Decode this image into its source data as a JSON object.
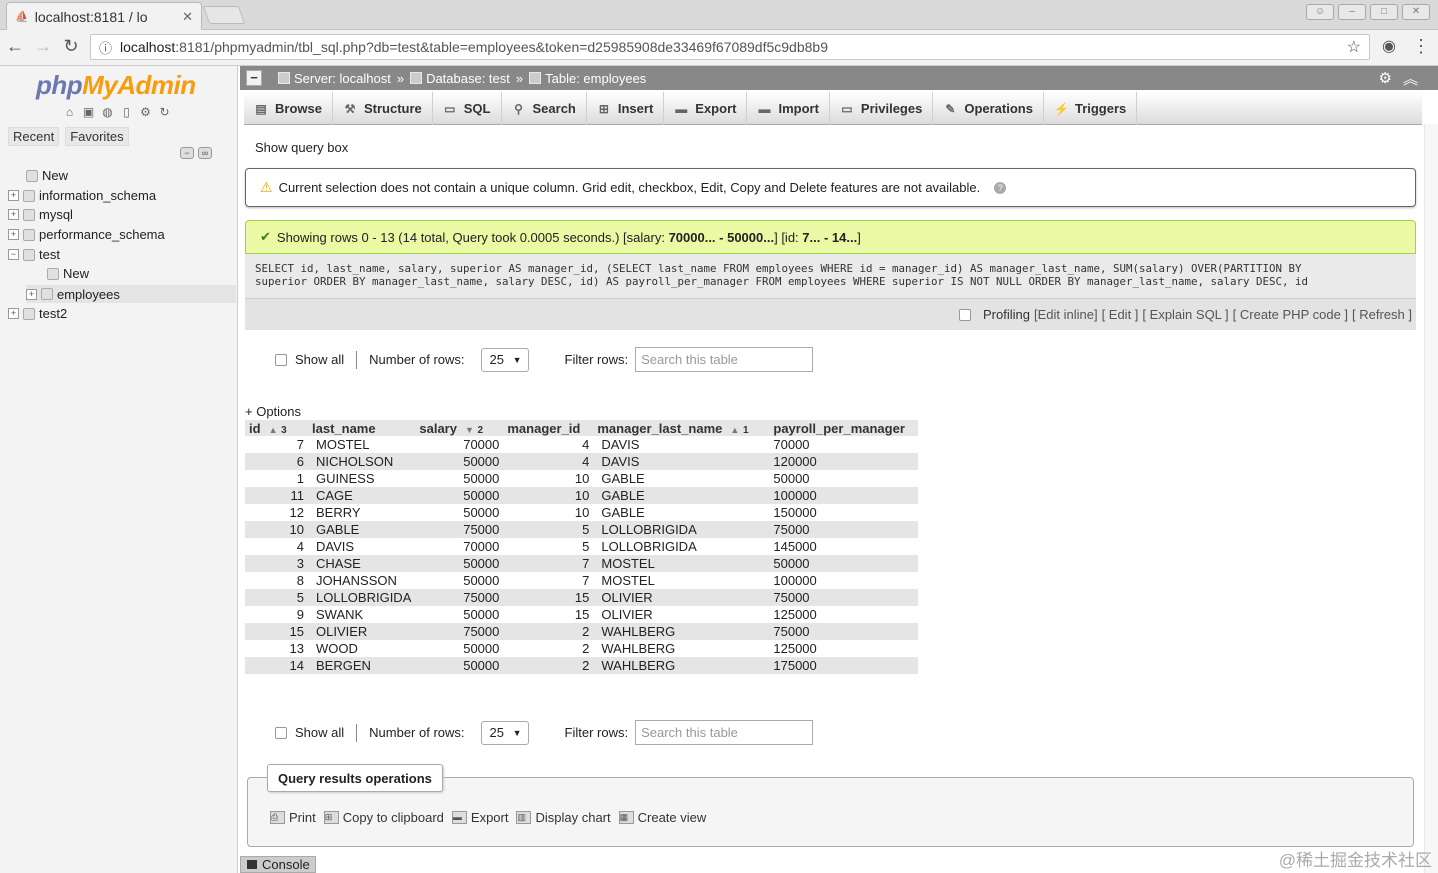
{
  "browser": {
    "tab_title": "localhost:8181 / lo",
    "url_host": "localhost",
    "url_rest": ":8181/phpmyadmin/tbl_sql.php?db=test&table=employees&token=d25985908de33469f67089df5c9db8b9"
  },
  "sidebar": {
    "logo_php": "php",
    "logo_myadmin": "MyAdmin",
    "tabs": [
      "Recent",
      "Favorites"
    ],
    "tree": [
      {
        "label": "New",
        "level": 1
      },
      {
        "label": "information_schema",
        "level": 0
      },
      {
        "label": "mysql",
        "level": 0
      },
      {
        "label": "performance_schema",
        "level": 0
      },
      {
        "label": "test",
        "level": 0
      },
      {
        "label": "New",
        "level": 2
      },
      {
        "label": "employees",
        "level": 2
      },
      {
        "label": "test2",
        "level": 0
      }
    ]
  },
  "breadcrumb": {
    "server": "Server: localhost",
    "database": "Database: test",
    "table": "Table: employees",
    "sep": "»"
  },
  "tabs": [
    "Browse",
    "Structure",
    "SQL",
    "Search",
    "Insert",
    "Export",
    "Import",
    "Privileges",
    "Operations",
    "Triggers"
  ],
  "show_query_box": "Show query box",
  "notice": "Current selection does not contain a unique column. Grid edit, checkbox, Edit, Copy and Delete features are not available.",
  "success": {
    "prefix": "Showing rows 0 - 13 (14 total, Query took 0.0005 seconds.) [salary: ",
    "salary_range": "70000... - 50000...",
    "mid": "] [id: ",
    "id_range": "7... - 14...",
    "suffix": "]"
  },
  "sql": {
    "line1": "SELECT id, last_name, salary, superior AS manager_id, (SELECT last_name FROM employees WHERE id = manager_id) AS manager_last_name, SUM(salary) OVER(PARTITION BY",
    "line2": "superior ORDER BY manager_last_name, salary DESC, id) AS payroll_per_manager FROM employees WHERE superior IS NOT NULL ORDER BY manager_last_name, salary DESC, id"
  },
  "sql_tools": {
    "profiling": "Profiling",
    "edit_inline": "[Edit inline]",
    "edit": "[ Edit ]",
    "explain": "[ Explain SQL ]",
    "php": "[ Create PHP code ]",
    "refresh": "[ Refresh ]"
  },
  "controls": {
    "show_all": "Show all",
    "num_rows_label": "Number of rows:",
    "num_rows_value": "25",
    "filter_label": "Filter rows:",
    "filter_placeholder": "Search this table"
  },
  "options_label": "+ Options",
  "table": {
    "headers": [
      {
        "label": "id",
        "sort": "▲",
        "order": "3"
      },
      {
        "label": "last_name",
        "sort": "",
        "order": ""
      },
      {
        "label": "salary",
        "sort": "▼",
        "order": "2"
      },
      {
        "label": "manager_id",
        "sort": "",
        "order": ""
      },
      {
        "label": "manager_last_name",
        "sort": "▲",
        "order": "1"
      },
      {
        "label": "payroll_per_manager",
        "sort": "",
        "order": ""
      }
    ],
    "rows": [
      [
        "7",
        "MOSTEL",
        "70000",
        "4",
        "DAVIS",
        "70000"
      ],
      [
        "6",
        "NICHOLSON",
        "50000",
        "4",
        "DAVIS",
        "120000"
      ],
      [
        "1",
        "GUINESS",
        "50000",
        "10",
        "GABLE",
        "50000"
      ],
      [
        "11",
        "CAGE",
        "50000",
        "10",
        "GABLE",
        "100000"
      ],
      [
        "12",
        "BERRY",
        "50000",
        "10",
        "GABLE",
        "150000"
      ],
      [
        "10",
        "GABLE",
        "75000",
        "5",
        "LOLLOBRIGIDA",
        "75000"
      ],
      [
        "4",
        "DAVIS",
        "70000",
        "5",
        "LOLLOBRIGIDA",
        "145000"
      ],
      [
        "3",
        "CHASE",
        "50000",
        "7",
        "MOSTEL",
        "50000"
      ],
      [
        "8",
        "JOHANSSON",
        "50000",
        "7",
        "MOSTEL",
        "100000"
      ],
      [
        "5",
        "LOLLOBRIGIDA",
        "75000",
        "15",
        "OLIVIER",
        "75000"
      ],
      [
        "9",
        "SWANK",
        "50000",
        "15",
        "OLIVIER",
        "125000"
      ],
      [
        "15",
        "OLIVIER",
        "75000",
        "2",
        "WAHLBERG",
        "75000"
      ],
      [
        "13",
        "WOOD",
        "50000",
        "2",
        "WAHLBERG",
        "125000"
      ],
      [
        "14",
        "BERGEN",
        "50000",
        "2",
        "WAHLBERG",
        "175000"
      ]
    ]
  },
  "query_ops": {
    "legend": "Query results operations",
    "links": [
      "Print",
      "Copy to clipboard",
      "Export",
      "Display chart",
      "Create view"
    ]
  },
  "console": "Console",
  "watermark": "@稀土掘金技术社区"
}
